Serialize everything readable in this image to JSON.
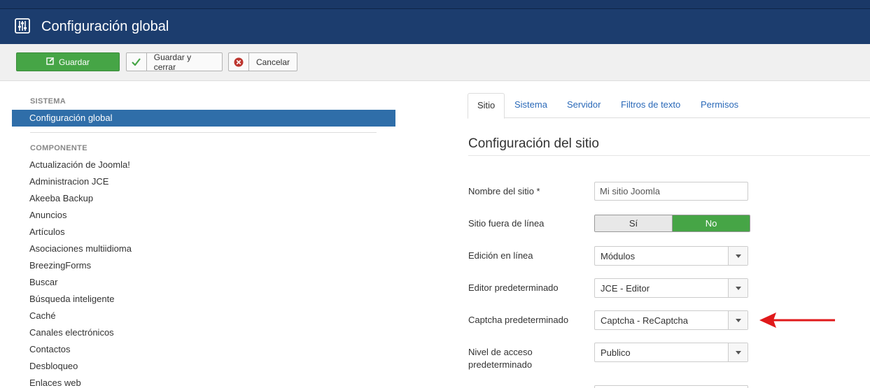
{
  "header": {
    "title": "Configuración global",
    "icon": "equalizer-icon"
  },
  "toolbar": {
    "save_label": "Guardar",
    "save_close_label": "Guardar y cerrar",
    "cancel_label": "Cancelar"
  },
  "sidebar": {
    "system_heading": "SISTEMA",
    "active_item": "Configuración global",
    "component_heading": "COMPONENTE",
    "items": [
      "Actualización de Joomla!",
      "Administracion JCE",
      "Akeeba Backup",
      "Anuncios",
      "Artículos",
      "Asociaciones multiidioma",
      "BreezingForms",
      "Buscar",
      "Búsqueda inteligente",
      "Caché",
      "Canales electrónicos",
      "Contactos",
      "Desbloqueo",
      "Enlaces web"
    ]
  },
  "tabs": [
    "Sitio",
    "Sistema",
    "Servidor",
    "Filtros de texto",
    "Permisos"
  ],
  "section_title": "Configuración del sitio",
  "form": {
    "site_name_label": "Nombre del sitio *",
    "site_name_value": "Mi sitio Joomla",
    "offline_label": "Sitio fuera de línea",
    "offline_yes": "Sí",
    "offline_no": "No",
    "inline_edit_label": "Edición en línea",
    "inline_edit_value": "Módulos",
    "default_editor_label": "Editor predeterminado",
    "default_editor_value": "JCE - Editor",
    "default_captcha_label": "Captcha predeterminado",
    "default_captcha_value": "Captcha - ReCaptcha",
    "access_level_label_1": "Nivel de acceso",
    "access_level_label_2": "predeterminado",
    "access_level_value": "Publico"
  },
  "colors": {
    "header_bg": "#1c3d6e",
    "accent_green": "#46a546",
    "active_blue": "#2f6ea9",
    "annotation_red": "#e0191b"
  }
}
